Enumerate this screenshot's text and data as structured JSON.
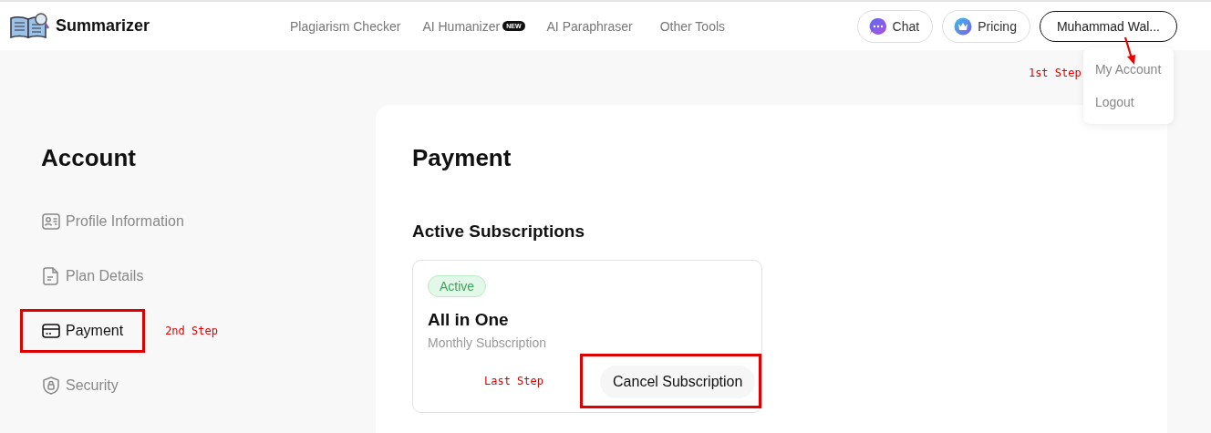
{
  "header": {
    "brand": "Summarizer",
    "nav": [
      {
        "label": "Plagiarism Checker"
      },
      {
        "label": "AI Humanizer",
        "badge": "NEW"
      },
      {
        "label": "AI Paraphraser"
      },
      {
        "label": "Other Tools"
      }
    ],
    "chat_button": "Chat",
    "pricing_button": "Pricing",
    "user_button": "Muhammad Wal...",
    "user_menu": {
      "annotation": "1st Step",
      "items": [
        "My Account",
        "Logout"
      ]
    }
  },
  "sidebar": {
    "title": "Account",
    "items": [
      {
        "label": "Profile Information",
        "kind": "profile",
        "selected": false,
        "highlighted": false
      },
      {
        "label": "Plan Details",
        "kind": "document",
        "selected": false,
        "highlighted": false
      },
      {
        "label": "Payment",
        "kind": "card",
        "selected": true,
        "highlighted": true,
        "annotation": "2nd Step"
      },
      {
        "label": "Security",
        "kind": "shield",
        "selected": false,
        "highlighted": false
      }
    ]
  },
  "main": {
    "title": "Payment",
    "section": "Active Subscriptions",
    "subscription": {
      "status": "Active",
      "plan": "All in One",
      "period": "Monthly Subscription",
      "annotation": "Last Step",
      "cancel_button": "Cancel Subscription",
      "highlighted": true
    }
  }
}
